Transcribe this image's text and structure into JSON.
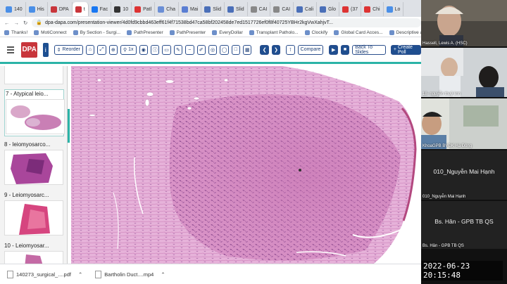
{
  "browser": {
    "tabs": [
      {
        "label": "140",
        "color": "#4a8fe7"
      },
      {
        "label": "His",
        "color": "#4a8fe7"
      },
      {
        "label": "DPA",
        "color": "#c8353b"
      },
      {
        "label": "t",
        "color": "#c8353b",
        "active": true
      },
      {
        "label": "Fac",
        "color": "#1877f2"
      },
      {
        "label": "10",
        "color": "#333"
      },
      {
        "label": "Patl",
        "color": "#d33"
      },
      {
        "label": "Cha",
        "color": "#6b8fd6"
      },
      {
        "label": "Mai",
        "color": "#5a7ed3"
      },
      {
        "label": "Slid",
        "color": "#4a6fb8"
      },
      {
        "label": "Slid",
        "color": "#4a6fb8"
      },
      {
        "label": "CAI",
        "color": "#888"
      },
      {
        "label": "CAI",
        "color": "#888"
      },
      {
        "label": "Cali",
        "color": "#4a6fb8"
      },
      {
        "label": "Glo",
        "color": "#4a6fb8"
      },
      {
        "label": "(37",
        "color": "#d33"
      },
      {
        "label": "Chi",
        "color": "#d33"
      },
      {
        "label": "Lo",
        "color": "#4a8fe7"
      }
    ],
    "url": "dpa-dapa.com/presentation-viewer/4d0fd9cbbd463eff61f4f71538bd47ca58bf202458de7ed1517726ef0f8f40725YBHr2kgVwXahjvT...",
    "bookmarks": [
      "Thanks!",
      "MotiConnect",
      "By Section - Surgi...",
      "PathPresenter",
      "PathPresenter",
      "EveryDollar",
      "Transplant Patholo...",
      "Clockify",
      "Global Card Acces...",
      "Descriptive a"
    ]
  },
  "toolbar": {
    "reorder": "Reorder",
    "zoom": "1x",
    "compare": "Compare",
    "back": "Back To Slides",
    "create": "Create Poll"
  },
  "slides": [
    {
      "label": "7 - Atypical leio...",
      "selected": true
    },
    {
      "label": "8 - leiomyosarco..."
    },
    {
      "label": "9 - Leiomyosarc..."
    },
    {
      "label": "10 - Leiomyosar..."
    }
  ],
  "downloads": [
    {
      "name": "140273_surgical_....pdf"
    },
    {
      "name": "Bartholin Duct....mp4"
    }
  ],
  "participants": [
    {
      "name": "Hassell, Lewis A. (HSC)",
      "kind": "video"
    },
    {
      "name": "18- nguyễn thuỷ linh",
      "kind": "video"
    },
    {
      "name": "KhoaGPB BVĐK Hà Đông",
      "kind": "video"
    },
    {
      "name": "010_Nguyễn Mai Hạnh",
      "center": "010_Nguyễn Mai Hạnh",
      "kind": "text"
    },
    {
      "name": "Bs. Hân - GPB TB QS",
      "center": "Bs. Hân - GPB TB QS",
      "kind": "text"
    }
  ],
  "timestamp": "2022-06-23 20:15:48"
}
